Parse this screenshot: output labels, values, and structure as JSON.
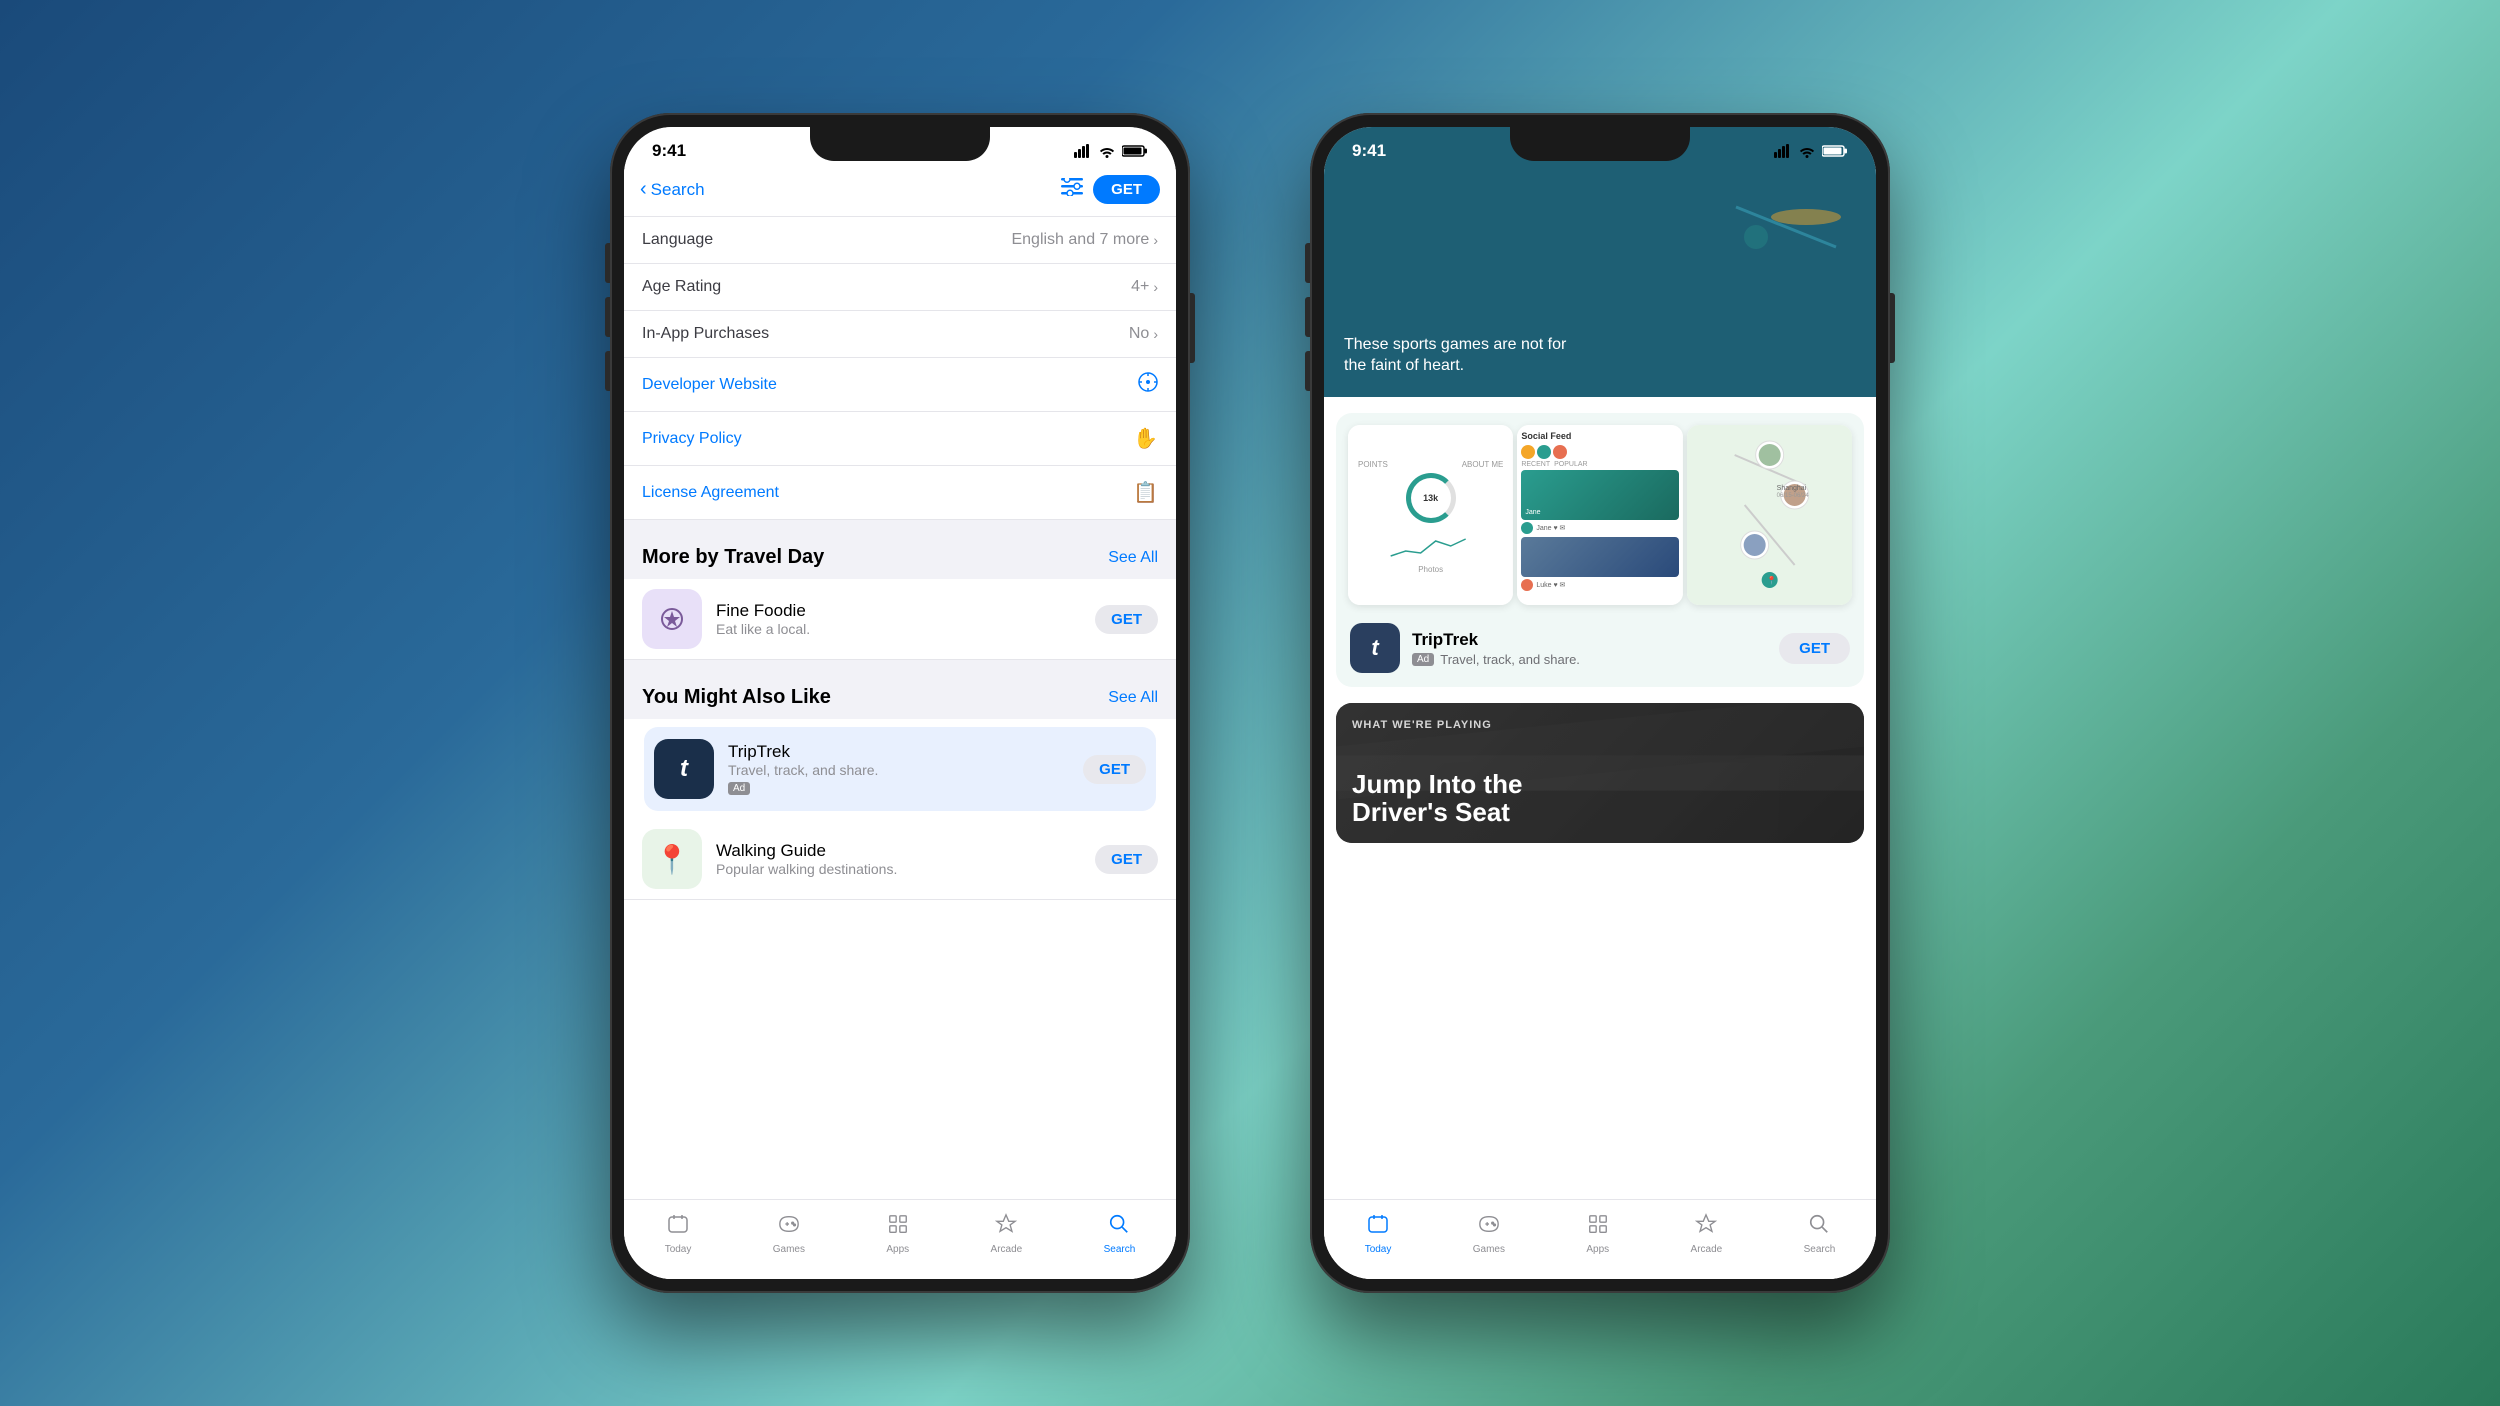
{
  "background": {
    "gradient": "linear-gradient(135deg, #1a4a7a 0%, #2a6a9a 30%, #7dd4c8 60%, #4a9a7a 80%, #2a7a5a 100%)"
  },
  "phone1": {
    "status_bar": {
      "time": "9:41",
      "signal": "●●●●",
      "wifi": "wifi",
      "battery": "battery"
    },
    "nav": {
      "back_label": "Search",
      "filter_icon": "filter-icon",
      "get_button": "GET"
    },
    "info_rows": [
      {
        "label": "Language",
        "value": "English and 7 more",
        "has_chevron": true
      },
      {
        "label": "Age Rating",
        "value": "4+",
        "has_chevron": true
      },
      {
        "label": "In-App Purchases",
        "value": "No",
        "has_chevron": true
      }
    ],
    "link_rows": [
      {
        "label": "Developer Website",
        "icon": "compass-icon"
      },
      {
        "label": "Privacy Policy",
        "icon": "hand-icon"
      },
      {
        "label": "License Agreement",
        "icon": "document-icon"
      }
    ],
    "more_by_section": {
      "title": "More by Travel Day",
      "see_all": "See All",
      "apps": [
        {
          "name": "Fine Foodie",
          "desc": "Eat like a local.",
          "icon_bg": "#e8e0f8",
          "icon_emoji": "🔍",
          "get_label": "GET"
        }
      ]
    },
    "also_like_section": {
      "title": "You Might Also Like",
      "see_all": "See All",
      "apps": [
        {
          "name": "TripTrek",
          "desc": "Travel, track, and share.",
          "ad": "Ad",
          "icon_bg": "#1a2f4a",
          "icon_text": "t",
          "get_label": "GET",
          "highlighted": true
        },
        {
          "name": "Walking Guide",
          "desc": "Popular walking destinations.",
          "icon_bg": "#e8f4e8",
          "icon_emoji": "📍",
          "get_label": "GET"
        }
      ]
    },
    "tab_bar": {
      "items": [
        {
          "icon": "📰",
          "label": "Today",
          "active": false
        },
        {
          "icon": "🎮",
          "label": "Games",
          "active": false
        },
        {
          "icon": "🎓",
          "label": "Apps",
          "active": false
        },
        {
          "icon": "👤",
          "label": "Arcade",
          "active": false
        },
        {
          "icon": "🔍",
          "label": "Search",
          "active": true
        }
      ]
    }
  },
  "phone2": {
    "status_bar": {
      "time": "9:41"
    },
    "sports_card": {
      "text_line1": "These sports games are not for",
      "text_line2": "the faint of heart.",
      "bg_color": "#1e5f74"
    },
    "triptrek_showcase": {
      "app_name": "TripTrek",
      "ad_label": "Ad",
      "app_desc": "Travel, track, and share.",
      "get_label": "GET",
      "icon_text": "t",
      "icon_bg": "#2a3f5f"
    },
    "screenshots": [
      {
        "type": "stats",
        "label": "Stats"
      },
      {
        "type": "social",
        "label": "Social Feed"
      },
      {
        "type": "map",
        "label": "Map"
      }
    ],
    "what_were_playing": {
      "eyebrow": "WHAT WE'RE PLAYING",
      "title_line1": "Jump Into the",
      "title_line2": "Driver's Seat"
    },
    "tab_bar": {
      "items": [
        {
          "icon": "📰",
          "label": "Today",
          "active": true
        },
        {
          "icon": "🎮",
          "label": "Games",
          "active": false
        },
        {
          "icon": "🎓",
          "label": "Apps",
          "active": false
        },
        {
          "icon": "👤",
          "label": "Arcade",
          "active": false
        },
        {
          "icon": "🔍",
          "label": "Search",
          "active": false
        }
      ]
    }
  }
}
